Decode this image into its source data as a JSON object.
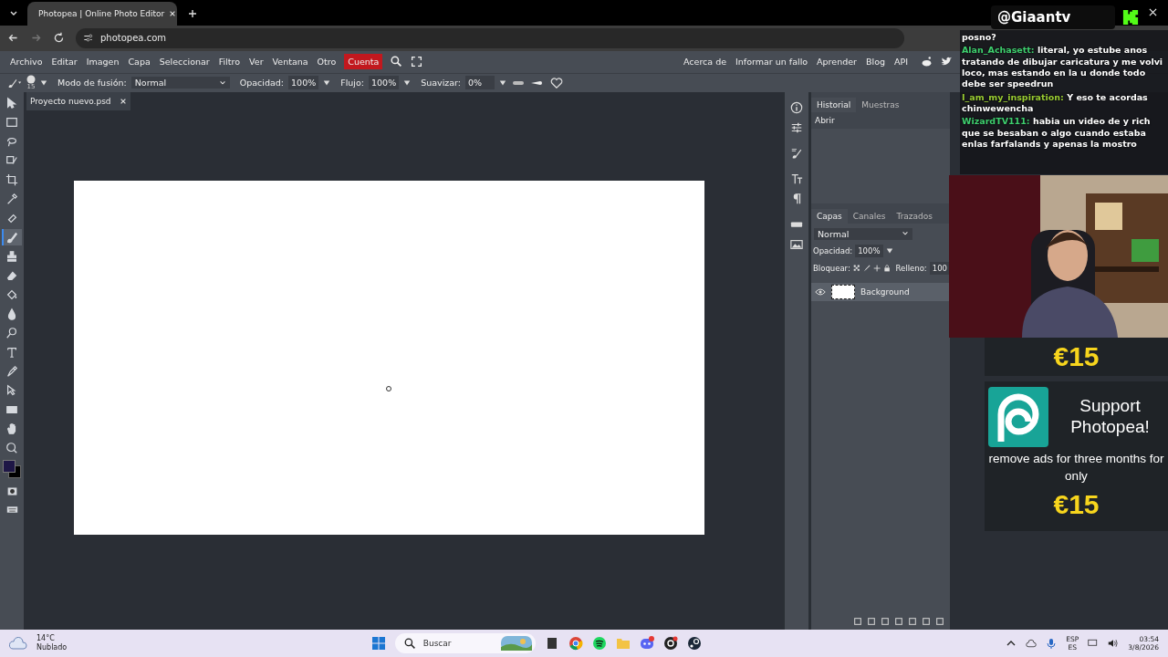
{
  "browser": {
    "tab_title": "Photopea | Online Photo Editor",
    "url": "photopea.com"
  },
  "menu": {
    "items": [
      "Archivo",
      "Editar",
      "Imagen",
      "Capa",
      "Seleccionar",
      "Filtro",
      "Ver",
      "Ventana",
      "Otro"
    ],
    "account": "Cuenta",
    "links": [
      "Acerca de",
      "Informar un fallo",
      "Aprender",
      "Blog",
      "API"
    ]
  },
  "options": {
    "brush_size": "15",
    "blend_label": "Modo de fusión:",
    "blend_value": "Normal",
    "opacity_label": "Opacidad:",
    "opacity_value": "100%",
    "flow_label": "Flujo:",
    "flow_value": "100%",
    "smooth_label": "Suavizar:",
    "smooth_value": "0%"
  },
  "document_tab": "Proyecto nuevo.psd",
  "tools": [
    {
      "kind": "move",
      "selected": false
    },
    {
      "kind": "marquee",
      "selected": false
    },
    {
      "kind": "lasso",
      "selected": false
    },
    {
      "kind": "quick-select",
      "selected": false
    },
    {
      "kind": "crop",
      "selected": false
    },
    {
      "kind": "eyedropper",
      "selected": false
    },
    {
      "kind": "heal",
      "selected": false
    },
    {
      "kind": "brush",
      "selected": true
    },
    {
      "kind": "stamp",
      "selected": false
    },
    {
      "kind": "eraser",
      "selected": false
    },
    {
      "kind": "bucket",
      "selected": false
    },
    {
      "kind": "blur",
      "selected": false
    },
    {
      "kind": "dodge",
      "selected": false
    },
    {
      "kind": "type",
      "selected": false
    },
    {
      "kind": "pen",
      "selected": false
    },
    {
      "kind": "path-select",
      "selected": false
    },
    {
      "kind": "rectangle",
      "selected": false
    },
    {
      "kind": "hand",
      "selected": false
    },
    {
      "kind": "zoom",
      "selected": false
    }
  ],
  "history": {
    "tabs": [
      {
        "label": "Historial",
        "selected": true
      },
      {
        "label": "Muestras",
        "selected": false
      }
    ],
    "items": [
      "Abrir"
    ]
  },
  "layers": {
    "tabs": [
      {
        "label": "Capas",
        "selected": true
      },
      {
        "label": "Canales",
        "selected": false
      },
      {
        "label": "Trazados",
        "selected": false
      }
    ],
    "blend_value": "Normal",
    "opacity_label": "Opacidad:",
    "opacity_value": "100%",
    "lock_label": "Bloquear:",
    "fill_label": "Relleno:",
    "fill_value": "100",
    "items": [
      {
        "name": "Background",
        "visible": true,
        "selected": true
      }
    ]
  },
  "stream": {
    "handle": "@Giaantv",
    "chat": [
      {
        "text": "posno?"
      },
      {
        "user": "Alan_Achasett:",
        "color": "#3ecf6e",
        "text": "literal, yo estube anos tratando de dibujar caricatura y me volvi loco, mas estando en la u donde todo debe ser speedrun"
      },
      {
        "user": "I_am_my_inspiration:",
        "color": "#9acd32",
        "text": "Y eso te acordas chinwewencha"
      },
      {
        "user": "WizardTV111:",
        "color": "#3ecf6e",
        "text": "habia un video de y rich que se besaban o algo cuando estaba enlas farfalands y apenas la mostro"
      }
    ],
    "ad_partial_price": "€15",
    "ad": {
      "title": "Support Photopea!",
      "body": "remove ads for three months for only",
      "price": "€15"
    }
  },
  "taskbar": {
    "temperature": "14°C",
    "weather": "Nublado",
    "search_placeholder": "Buscar",
    "lang_top": "ESP",
    "lang_bottom": "ES",
    "time": "03:54",
    "date": "3/8/2026"
  }
}
